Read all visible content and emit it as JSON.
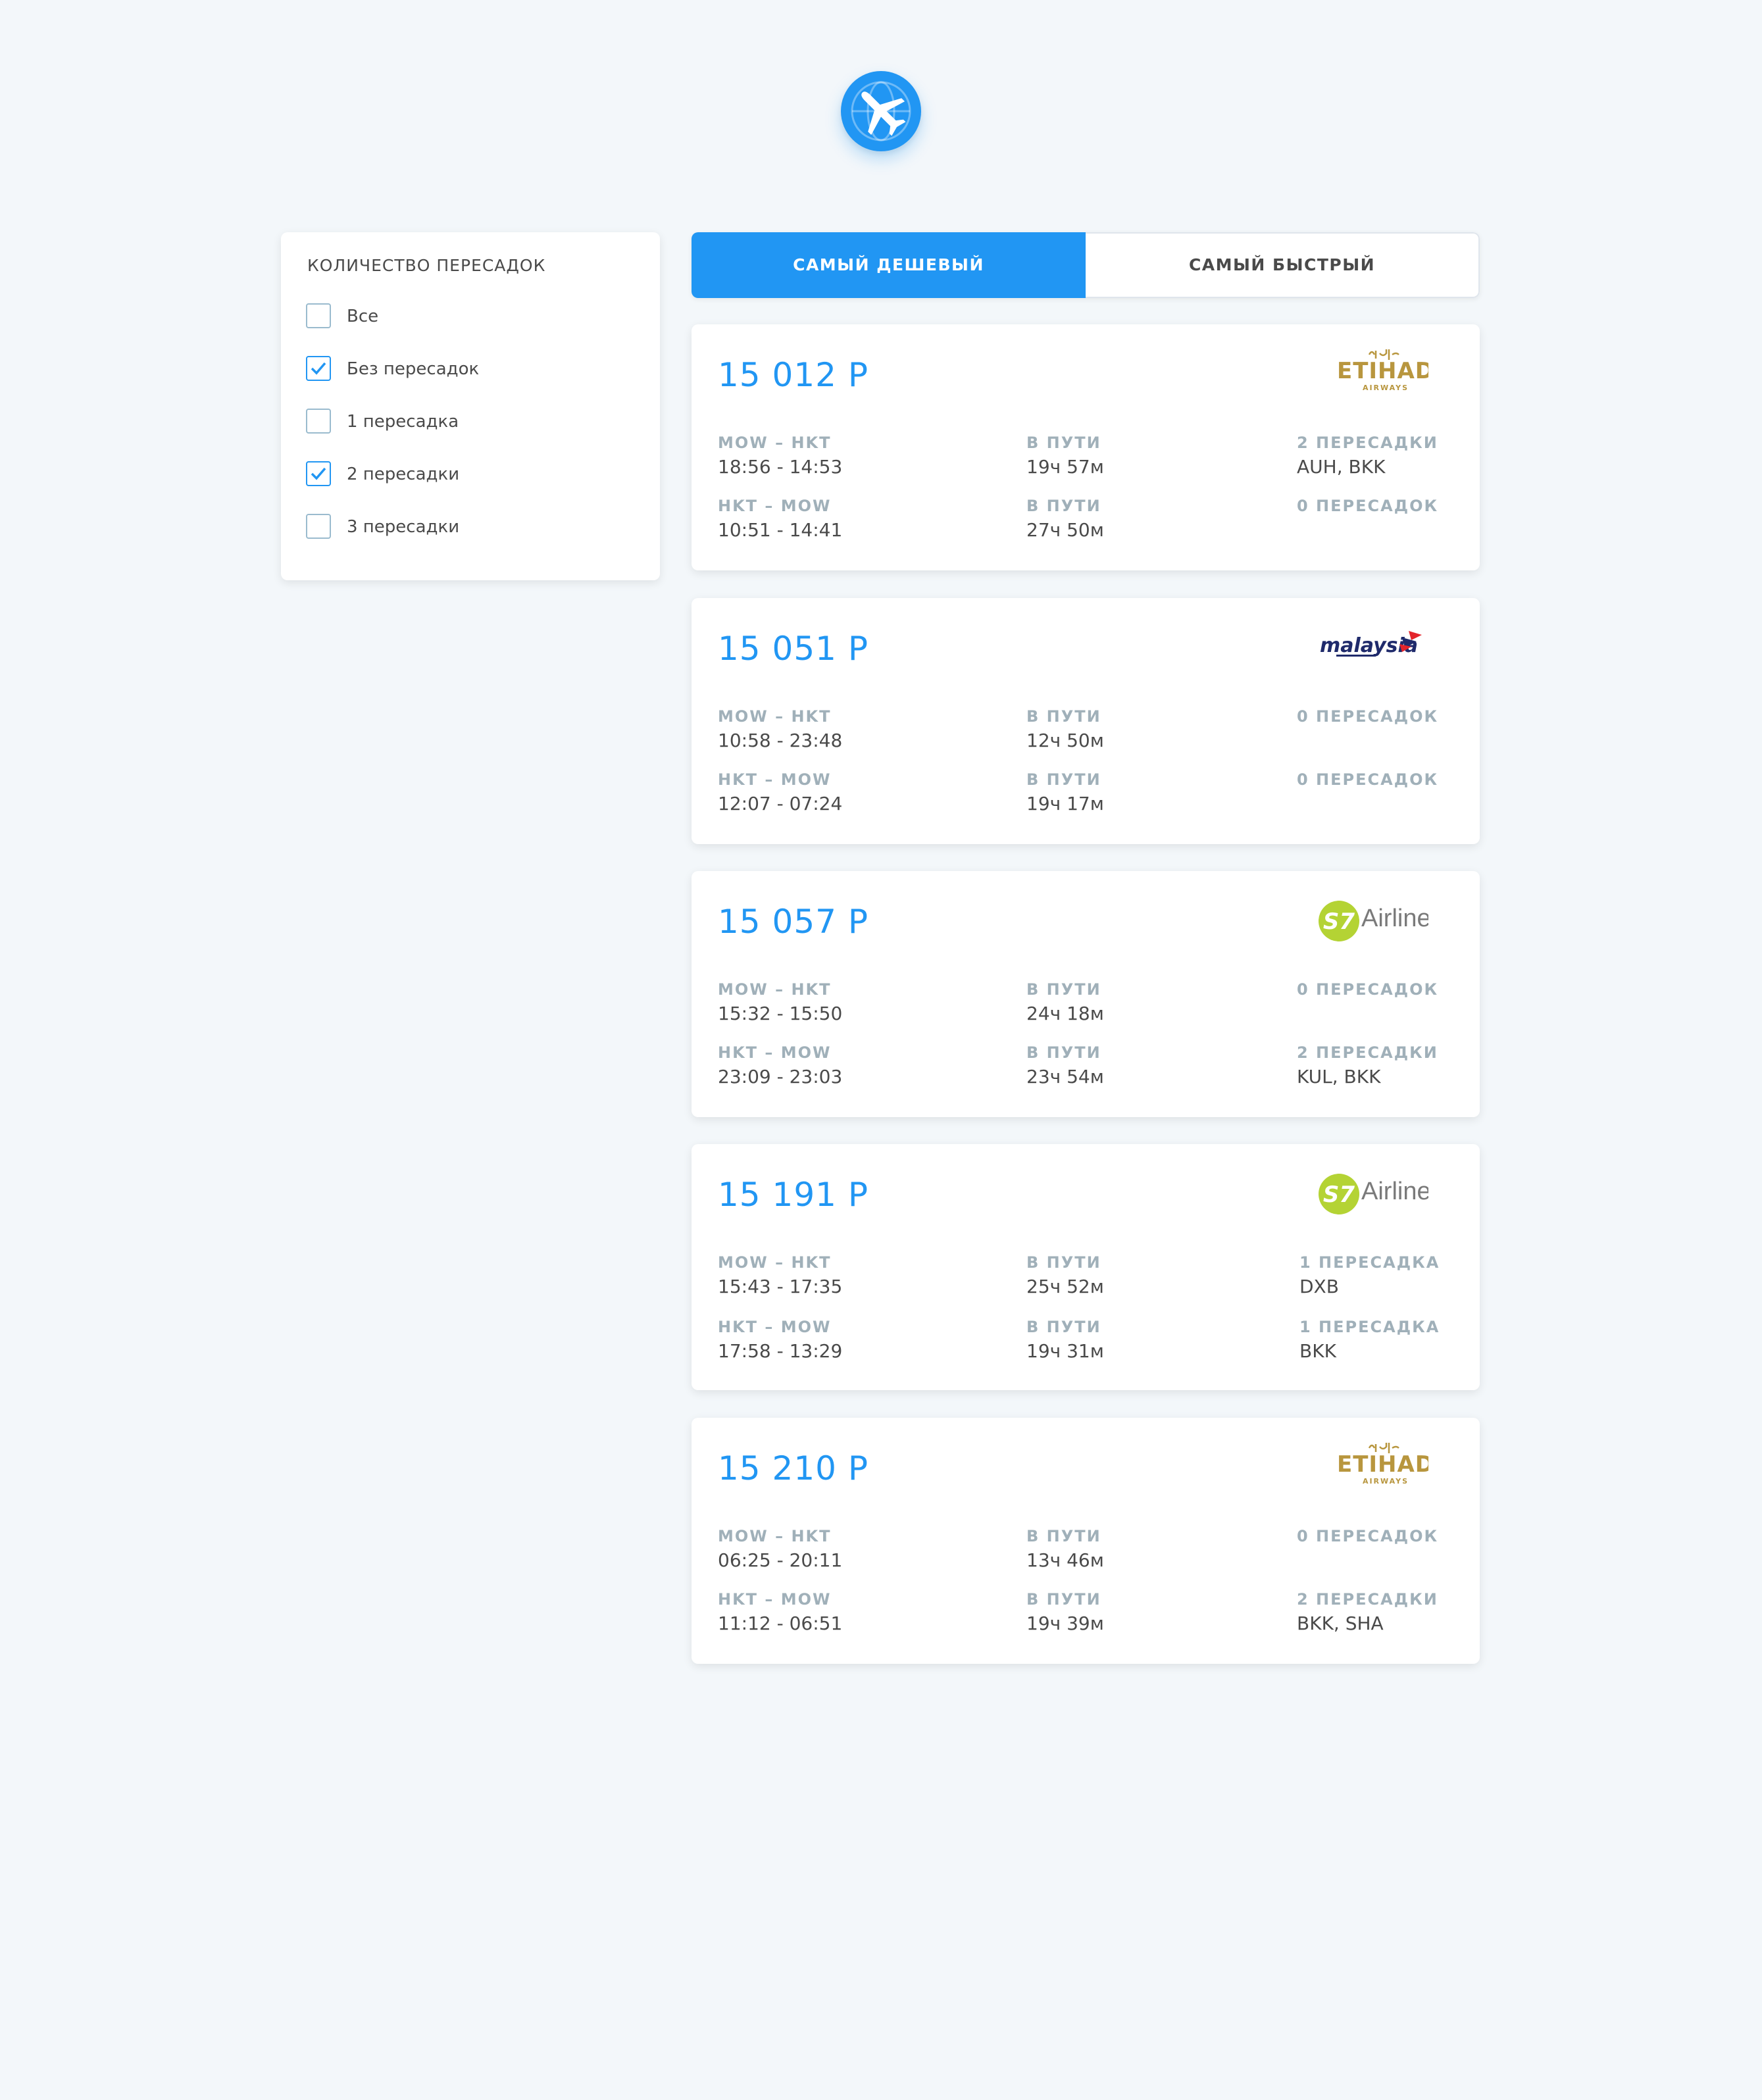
{
  "brand": {
    "logo_icon": "airplane-globe-icon",
    "color": "#2196f3"
  },
  "filters": {
    "title": "КОЛИЧЕСТВО ПЕРЕСАДОК",
    "options": [
      {
        "label": "Все",
        "checked": false
      },
      {
        "label": "Без пересадок",
        "checked": true
      },
      {
        "label": "1 пересадка",
        "checked": false
      },
      {
        "label": "2 пересадки",
        "checked": true
      },
      {
        "label": "3 пересадки",
        "checked": false
      }
    ]
  },
  "tabs": [
    {
      "label": "САМЫЙ ДЕШЕВЫЙ",
      "active": true
    },
    {
      "label": "САМЫЙ БЫСТРЫЙ",
      "active": false
    }
  ],
  "tickets": [
    {
      "price": "15 012 Р",
      "carrier": "ETIHAD AIRWAYS",
      "segments": [
        {
          "route": "MOW – HKT",
          "time": "18:56 - 14:53",
          "duration_label": "В ПУТИ",
          "duration": "19ч 57м",
          "stops_label": "2 ПЕРЕСАДКИ",
          "stops": "AUH, BKK"
        },
        {
          "route": "HKT – MOW",
          "time": "10:51 - 14:41",
          "duration_label": "В ПУТИ",
          "duration": "27ч 50м",
          "stops_label": "0 ПЕРЕСАДОК",
          "stops": ""
        }
      ]
    },
    {
      "price": "15 051 Р",
      "carrier": "malaysia",
      "segments": [
        {
          "route": "MOW – HKT",
          "time": "10:58 - 23:48",
          "duration_label": "В ПУТИ",
          "duration": "12ч 50м",
          "stops_label": "0 ПЕРЕСАДОК",
          "stops": ""
        },
        {
          "route": "HKT – MOW",
          "time": "12:07 - 07:24",
          "duration_label": "В ПУТИ",
          "duration": "19ч 17м",
          "stops_label": "0 ПЕРЕСАДОК",
          "stops": ""
        }
      ]
    },
    {
      "price": "15 057 Р",
      "carrier": "S7 Airlines",
      "segments": [
        {
          "route": "MOW – HKT",
          "time": "15:32 - 15:50",
          "duration_label": "В ПУТИ",
          "duration": "24ч 18м",
          "stops_label": "0 ПЕРЕСАДОК",
          "stops": ""
        },
        {
          "route": "HKT – MOW",
          "time": "23:09 - 23:03",
          "duration_label": "В ПУТИ",
          "duration": "23ч 54м",
          "stops_label": "2 ПЕРЕСАДКИ",
          "stops": "KUL, BKK"
        }
      ]
    },
    {
      "price": "15 191 Р",
      "carrier": "S7 Airlines",
      "segments": [
        {
          "route": "MOW – HKT",
          "time": "15:43 - 17:35",
          "duration_label": "В ПУТИ",
          "duration": "25ч 52м",
          "stops_label": "1 ПЕРЕСАДКА",
          "stops": "DXB"
        },
        {
          "route": "HKT – MOW",
          "time": "17:58 - 13:29",
          "duration_label": "В ПУТИ",
          "duration": "19ч 31м",
          "stops_label": "1 ПЕРЕСАДКА",
          "stops": "BKK"
        }
      ]
    },
    {
      "price": "15 210 Р",
      "carrier": "ETIHAD AIRWAYS",
      "segments": [
        {
          "route": "MOW – HKT",
          "time": "06:25 - 20:11",
          "duration_label": "В ПУТИ",
          "duration": "13ч 46м",
          "stops_label": "0 ПЕРЕСАДОК",
          "stops": ""
        },
        {
          "route": "HKT – MOW",
          "time": "11:12 - 06:51",
          "duration_label": "В ПУТИ",
          "duration": "19ч 39м",
          "stops_label": "2 ПЕРЕСАДКИ",
          "stops": "BKK, SHA"
        }
      ]
    }
  ]
}
